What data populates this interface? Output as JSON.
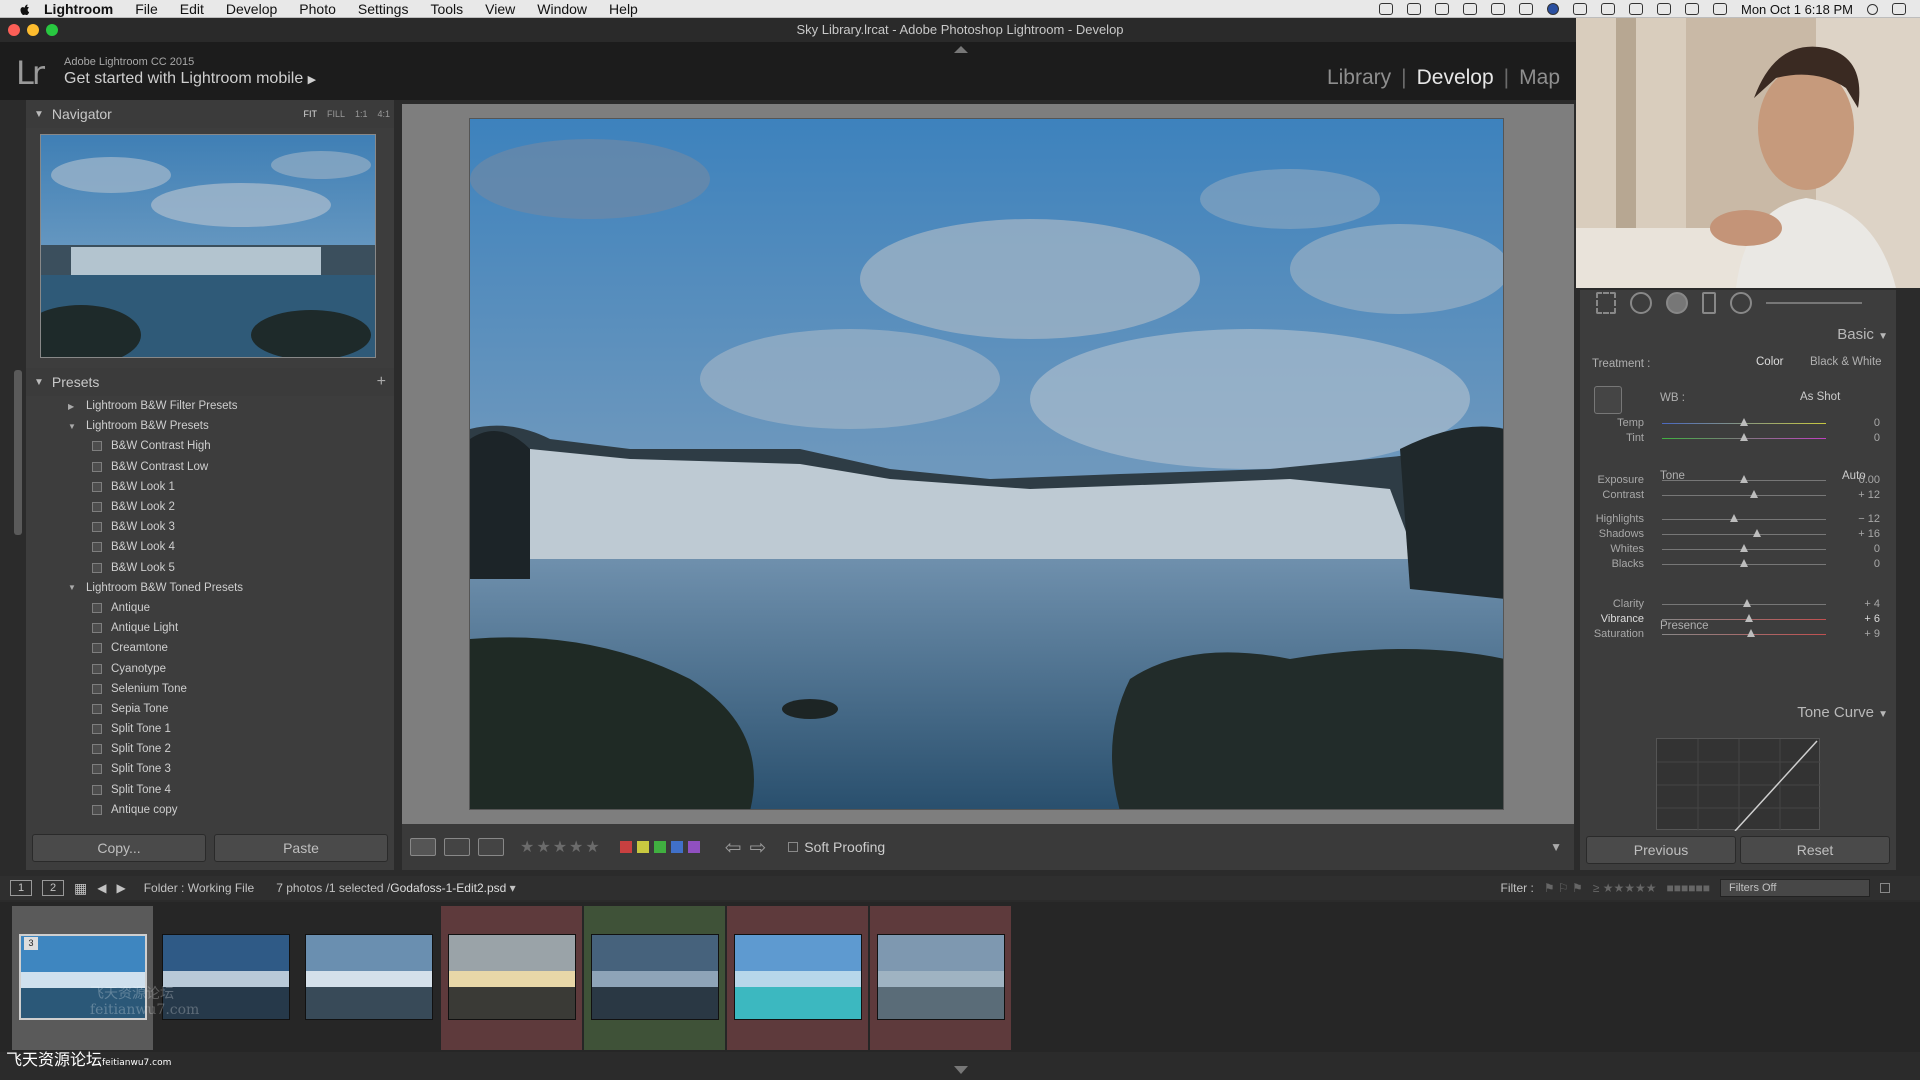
{
  "menubar": {
    "items": [
      "Lightroom",
      "File",
      "Edit",
      "Develop",
      "Photo",
      "Settings",
      "Tools",
      "View",
      "Window",
      "Help"
    ],
    "clock": "Mon Oct 1  6:18 PM"
  },
  "window": {
    "title": "Sky Library.lrcat - Adobe Photoshop Lightroom - Develop"
  },
  "identity": {
    "version": "Adobe Lightroom CC 2015",
    "mobile": "Get started with Lightroom mobile",
    "modules": [
      "Library",
      "Develop",
      "Map"
    ],
    "active_module": "Develop"
  },
  "navigator": {
    "title": "Navigator",
    "options": [
      "FIT",
      "FILL",
      "1:1",
      "4:1"
    ]
  },
  "presets": {
    "title": "Presets",
    "rows": [
      {
        "type": "folder",
        "open": false,
        "label": "Lightroom B&W Filter Presets"
      },
      {
        "type": "folder",
        "open": true,
        "label": "Lightroom B&W Presets"
      },
      {
        "type": "item",
        "label": "B&W Contrast High"
      },
      {
        "type": "item",
        "label": "B&W Contrast Low"
      },
      {
        "type": "item",
        "label": "B&W Look 1"
      },
      {
        "type": "item",
        "label": "B&W Look 2"
      },
      {
        "type": "item",
        "label": "B&W Look 3"
      },
      {
        "type": "item",
        "label": "B&W Look 4"
      },
      {
        "type": "item",
        "label": "B&W Look 5"
      },
      {
        "type": "folder",
        "open": true,
        "label": "Lightroom B&W Toned Presets"
      },
      {
        "type": "item",
        "label": "Antique"
      },
      {
        "type": "item",
        "label": "Antique Light"
      },
      {
        "type": "item",
        "label": "Creamtone"
      },
      {
        "type": "item",
        "label": "Cyanotype"
      },
      {
        "type": "item",
        "label": "Selenium Tone"
      },
      {
        "type": "item",
        "label": "Sepia Tone"
      },
      {
        "type": "item",
        "label": "Split Tone 1"
      },
      {
        "type": "item",
        "label": "Split Tone 2"
      },
      {
        "type": "item",
        "label": "Split Tone 3"
      },
      {
        "type": "item",
        "label": "Split Tone 4"
      },
      {
        "type": "item",
        "label": "Antique copy"
      }
    ],
    "copy_label": "Copy...",
    "paste_label": "Paste"
  },
  "toolbar": {
    "soft_proofing": "Soft Proofing",
    "label_colors": [
      "#c84040",
      "#c8c840",
      "#40b040",
      "#4070c8",
      "#9050c0"
    ]
  },
  "basic": {
    "section": "Basic",
    "treatment_label": "Treatment :",
    "color": "Color",
    "bw": "Black & White",
    "wb_label": "WB :",
    "wb_value": "As Shot",
    "tone_label": "Tone",
    "auto": "Auto",
    "presence_label": "Presence",
    "sliders": [
      {
        "label": "Temp",
        "value": "0",
        "pos": 0.5
      },
      {
        "label": "Tint",
        "value": "0",
        "pos": 0.5
      },
      {
        "label": "Exposure",
        "value": "0.00",
        "pos": 0.5
      },
      {
        "label": "Contrast",
        "value": "+ 12",
        "pos": 0.56
      },
      {
        "label": "Highlights",
        "value": "− 12",
        "pos": 0.44
      },
      {
        "label": "Shadows",
        "value": "+ 16",
        "pos": 0.58
      },
      {
        "label": "Whites",
        "value": "0",
        "pos": 0.5
      },
      {
        "label": "Blacks",
        "value": "0",
        "pos": 0.5
      },
      {
        "label": "Clarity",
        "value": "+ 4",
        "pos": 0.52
      },
      {
        "label": "Vibrance",
        "value": "+ 6",
        "pos": 0.53
      },
      {
        "label": "Saturation",
        "value": "+ 9",
        "pos": 0.545
      }
    ]
  },
  "tone_curve": {
    "section": "Tone Curve"
  },
  "right_buttons": {
    "previous": "Previous",
    "reset": "Reset"
  },
  "filmhead": {
    "screen1": "1",
    "screen2": "2",
    "folder": "Folder : Working File",
    "count": "7 photos /1 selected /",
    "filename": "Godafoss-1-Edit2.psd",
    "filter_label": "Filter :",
    "filter_value": "Filters Off"
  },
  "filmstrip": {
    "selected_index": 0,
    "first_badge": "3",
    "cell_tints": [
      "#5a5a5a",
      "#262626",
      "#262626",
      "#5e3a3c",
      "#3f5238",
      "#5e3a3c",
      "#5e3a3c"
    ]
  },
  "watermark": {
    "site_cn": "飞天资源论坛",
    "site_en": "feitianwu7.com",
    "overlay_cn": "飞天资源论坛",
    "overlay_en": "feitianwu7.com"
  }
}
